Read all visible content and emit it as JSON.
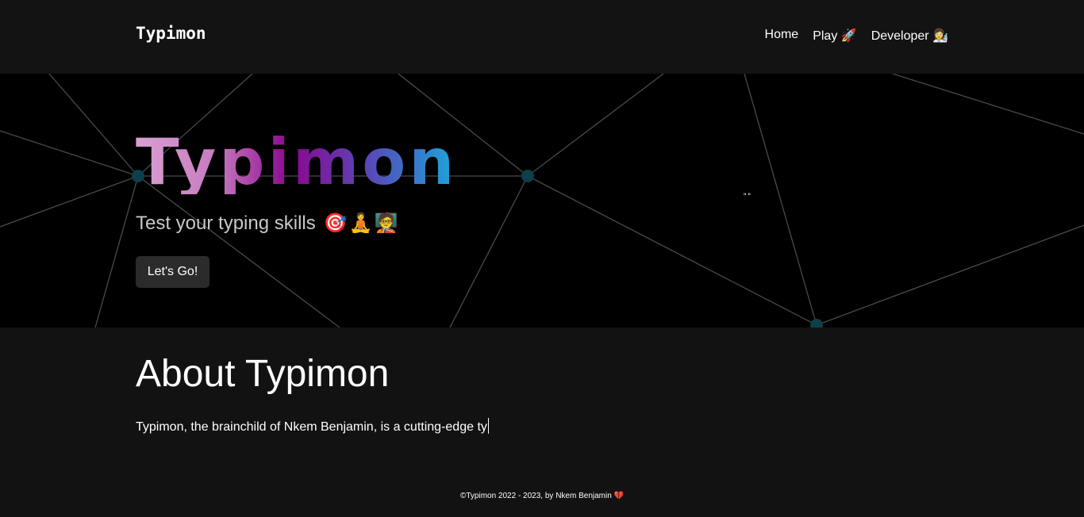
{
  "navbar": {
    "brand": "Typimon",
    "links": [
      {
        "label": "Home"
      },
      {
        "label": "Play 🚀"
      },
      {
        "label": "Developer 👩‍🔬"
      }
    ]
  },
  "hero": {
    "title": "Typimon",
    "subtitle": "Test your typing skills",
    "subtitle_emojis": "🎯🧘🧑‍🏫",
    "cta_label": "Let's Go!",
    "quote_mark": "\"\"",
    "title_gradient": [
      "#d9a0d2",
      "#c77bbf",
      "#8a078f",
      "#5a46b8",
      "#1ba7d9"
    ],
    "node_color": "#0f3f4a",
    "line_color": "#4a4a4a"
  },
  "about": {
    "title": "About Typimon",
    "text": "Typimon, the brainchild of Nkem Benjamin, is a cutting-edge ty"
  },
  "footer": {
    "text": "©Typimon 2022 - 2023, by Nkem Benjamin 💔"
  }
}
